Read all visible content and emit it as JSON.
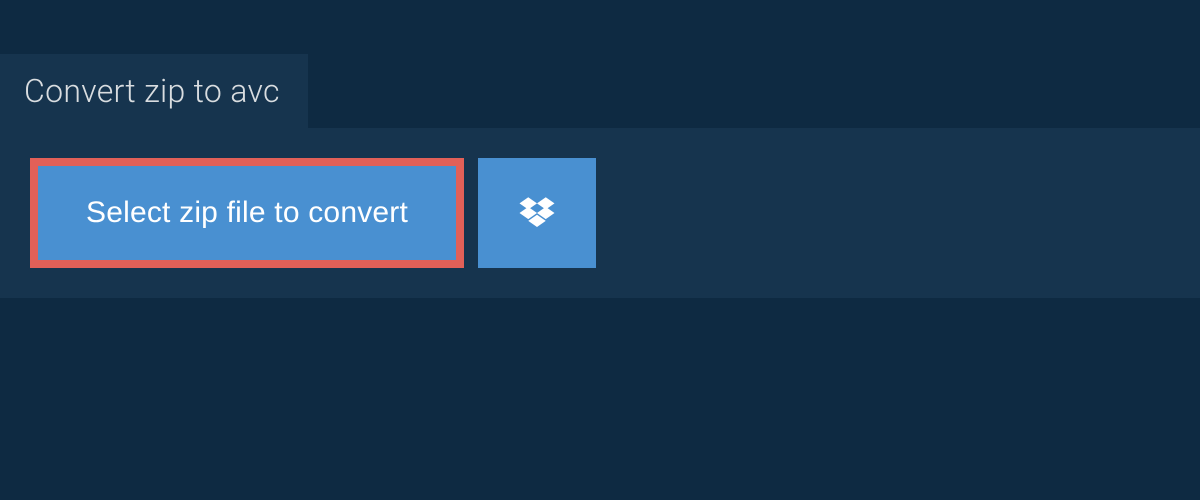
{
  "header": {
    "title": "Convert zip to avc"
  },
  "actions": {
    "select_file_label": "Select zip file to convert"
  },
  "colors": {
    "background": "#0e2a42",
    "panel": "#16344e",
    "button": "#4990d1",
    "highlight_border": "#e26058",
    "text_light": "#d9dde0",
    "text_white": "#ffffff"
  }
}
